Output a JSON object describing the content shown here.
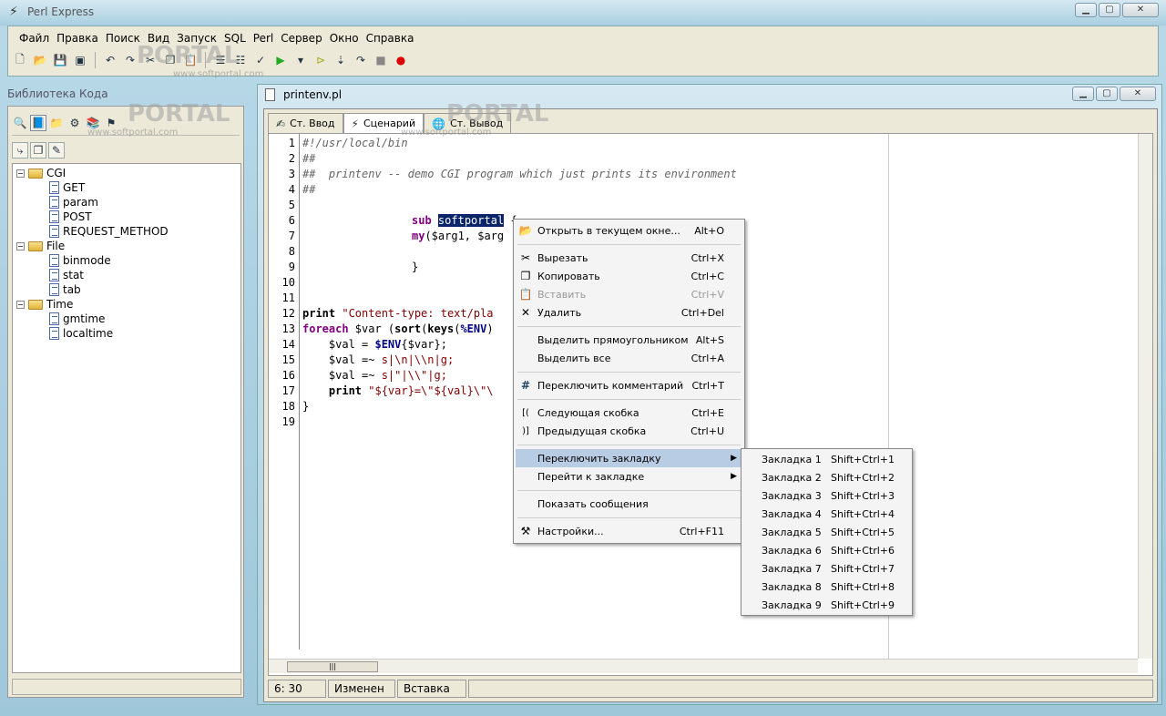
{
  "app": {
    "title": "Perl Express"
  },
  "menu": [
    "Файл",
    "Правка",
    "Поиск",
    "Вид",
    "Запуск",
    "SQL",
    "Perl",
    "Сервер",
    "Окно",
    "Справка"
  ],
  "library": {
    "title": "Библиотека Кода",
    "tree": [
      {
        "label": "CGI",
        "type": "folder"
      },
      {
        "label": "GET",
        "type": "doc"
      },
      {
        "label": "param",
        "type": "doc"
      },
      {
        "label": "POST",
        "type": "doc"
      },
      {
        "label": "REQUEST_METHOD",
        "type": "doc"
      },
      {
        "label": "File",
        "type": "folder"
      },
      {
        "label": "binmode",
        "type": "doc"
      },
      {
        "label": "stat",
        "type": "doc"
      },
      {
        "label": "tab",
        "type": "doc"
      },
      {
        "label": "Time",
        "type": "folder"
      },
      {
        "label": "gmtime",
        "type": "doc"
      },
      {
        "label": "localtime",
        "type": "doc"
      }
    ]
  },
  "editor": {
    "filename": "printenv.pl",
    "tabs": [
      "Ст. Ввод",
      "Сценарий",
      "Ст. Вывод"
    ],
    "line_numbers": [
      "1",
      "2",
      "3",
      "4",
      "5",
      "6",
      "7",
      "8",
      "9",
      "10",
      "11",
      "12",
      "13",
      "14",
      "15",
      "16",
      "17",
      "18",
      "19"
    ],
    "code": {
      "l1": "#!/usr/local/bin",
      "l2": "##",
      "l3": "##  printenv -- demo CGI program which just prints its environment",
      "l4": "##",
      "l6_kw": "sub",
      "l6_sel": "softportal",
      "l6_rest": " {",
      "l7_kw": "my",
      "l7_rest": "($arg1, $arg",
      "l9": "}",
      "l12_kw": "print",
      "l12_str": "\"Content-type: text/pla",
      "l13_kw": "foreach",
      "l13_rest": " $var (",
      "l13_kw2": "sort",
      "l13_rest2": "(",
      "l13_kw3": "keys",
      "l13_rest3": "(",
      "l13_evar": "%ENV",
      "l13_rest4": ")",
      "l14_a": "    $val = ",
      "l14_evar": "$ENV",
      "l14_b": "{$var};",
      "l15_a": "    $val =~ ",
      "l15_str": "s|\\n|\\\\n|g;",
      "l16_a": "    $val =~ ",
      "l16_str": "s|\"|\\\\\"|g;",
      "l17_kw": "    print",
      "l17_str": " \"${var}=\\\"${val}\\\"\\",
      "l18": "}"
    },
    "status": {
      "position": "6: 30",
      "modified": "Изменен",
      "mode": "Вставка"
    }
  },
  "context_menu": [
    {
      "icon": "open-icon",
      "glyph": "📂",
      "label": "Открыть в текущем окне...",
      "shortcut": "Alt+O",
      "enabled": true
    },
    {
      "icon": "cut-icon",
      "glyph": "✂",
      "label": "Вырезать",
      "shortcut": "Ctrl+X",
      "enabled": true
    },
    {
      "icon": "copy-icon",
      "glyph": "❐",
      "label": "Копировать",
      "shortcut": "Ctrl+C",
      "enabled": true
    },
    {
      "icon": "paste-icon",
      "glyph": "📋",
      "label": "Вставить",
      "shortcut": "Ctrl+V",
      "enabled": false
    },
    {
      "icon": "delete-icon",
      "glyph": "✕",
      "label": "Удалить",
      "shortcut": "Ctrl+Del",
      "enabled": true
    },
    {
      "icon": "",
      "glyph": "",
      "label": "Выделить прямоугольником",
      "shortcut": "Alt+S",
      "enabled": true
    },
    {
      "icon": "",
      "glyph": "",
      "label": "Выделить все",
      "shortcut": "Ctrl+A",
      "enabled": true
    },
    {
      "icon": "hash-icon",
      "glyph": "#",
      "label": "Переключить комментарий",
      "shortcut": "Ctrl+T",
      "enabled": true
    },
    {
      "icon": "bracket-next-icon",
      "glyph": "[(",
      "label": "Следующая скобка",
      "shortcut": "Ctrl+E",
      "enabled": true
    },
    {
      "icon": "bracket-prev-icon",
      "glyph": ")]",
      "label": "Предыдущая скобка",
      "shortcut": "Ctrl+U",
      "enabled": true
    },
    {
      "icon": "",
      "glyph": "",
      "label": "Переключить закладку",
      "shortcut": "",
      "enabled": true
    },
    {
      "icon": "",
      "glyph": "",
      "label": "Перейти к закладке",
      "shortcut": "",
      "enabled": true
    },
    {
      "icon": "",
      "glyph": "",
      "label": "Показать сообщения",
      "shortcut": "",
      "enabled": true
    },
    {
      "icon": "settings-icon",
      "glyph": "⚒",
      "label": "Настройки...",
      "shortcut": "Ctrl+F11",
      "enabled": true
    }
  ],
  "submenu": [
    {
      "label": "Закладка 1",
      "shortcut": "Shift+Ctrl+1"
    },
    {
      "label": "Закладка 2",
      "shortcut": "Shift+Ctrl+2"
    },
    {
      "label": "Закладка 3",
      "shortcut": "Shift+Ctrl+3"
    },
    {
      "label": "Закладка 4",
      "shortcut": "Shift+Ctrl+4"
    },
    {
      "label": "Закладка 5",
      "shortcut": "Shift+Ctrl+5"
    },
    {
      "label": "Закладка 6",
      "shortcut": "Shift+Ctrl+6"
    },
    {
      "label": "Закладка 7",
      "shortcut": "Shift+Ctrl+7"
    },
    {
      "label": "Закладка 8",
      "shortcut": "Shift+Ctrl+8"
    },
    {
      "label": "Закладка 9",
      "shortcut": "Shift+Ctrl+9"
    }
  ],
  "watermark": {
    "text": "PORTAL",
    "url": "www.softportal.com"
  }
}
